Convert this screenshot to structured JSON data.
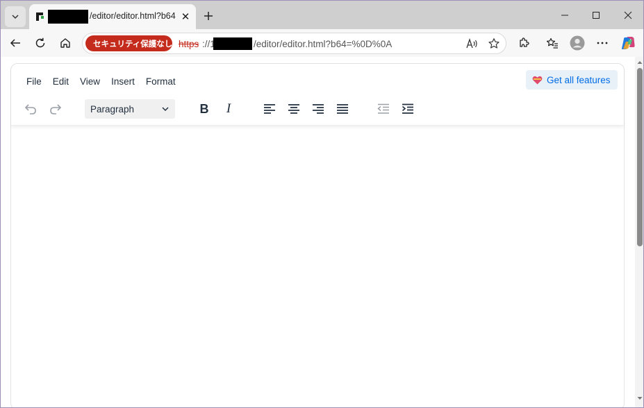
{
  "browser": {
    "tab": {
      "title": "/editor/editor.html?b64",
      "close_glyph": "✕"
    },
    "new_tab_label": "+",
    "security_badge": "セキュリティ保護なし",
    "url": {
      "scheme": "https",
      "separator": "://1",
      "path": "/editor/editor.html?b64=%0D%0A"
    },
    "icons": [
      "tab-list-icon",
      "favicon-icon",
      "new-tab-icon",
      "minimize-icon",
      "maximize-icon",
      "close-icon",
      "back-icon",
      "refresh-icon",
      "home-icon",
      "shield-icon",
      "read-aloud-icon",
      "favorite-star-icon",
      "extensions-icon",
      "favorites-icon",
      "profile-icon",
      "more-icon",
      "copilot-icon"
    ]
  },
  "editor": {
    "menu": [
      "File",
      "Edit",
      "View",
      "Insert",
      "Format"
    ],
    "upgrade_label": "Get all features",
    "block_format": "Paragraph",
    "toolbar_icons": [
      "undo-icon",
      "redo-icon",
      "bold-icon",
      "italic-icon",
      "align-left-icon",
      "align-center-icon",
      "align-right-icon",
      "justify-icon",
      "outdent-icon",
      "indent-icon"
    ],
    "bold_glyph": "B",
    "italic_glyph": "I"
  },
  "colors": {
    "insecure_red": "#c42b1c",
    "link_blue": "#006ce7",
    "toolbar_text": "#222f3e"
  }
}
